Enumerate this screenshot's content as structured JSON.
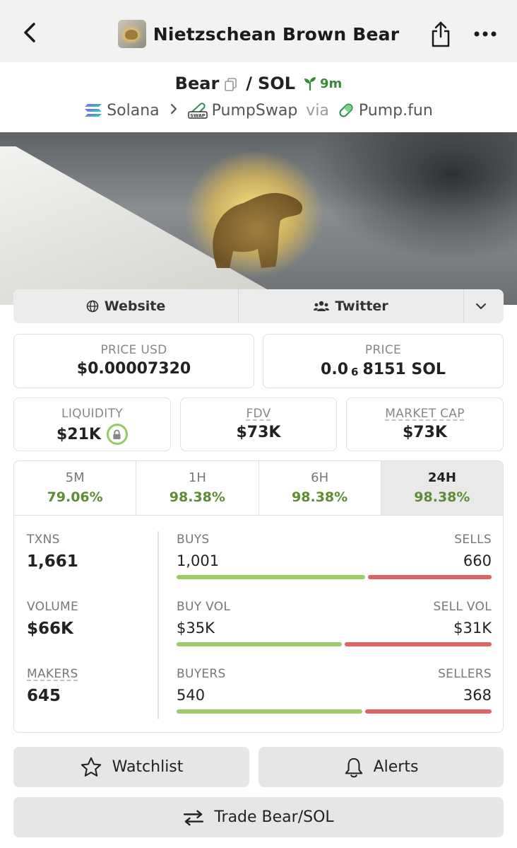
{
  "header": {
    "title": "Nietzschean Brown Bear"
  },
  "pair": {
    "base": "Bear",
    "slash": "/",
    "quote": "SOL",
    "age": "9m"
  },
  "chain": {
    "network": "Solana",
    "dex": "PumpSwap",
    "via": "via",
    "launchpad": "Pump.fun"
  },
  "links": {
    "website": "Website",
    "twitter": "Twitter"
  },
  "stats": {
    "price_usd_label": "PRICE USD",
    "price_usd": "$0.00007320",
    "price_label": "PRICE",
    "price_prefix": "0.0",
    "price_zeros": "6",
    "price_digits": "8151 SOL",
    "liquidity_label": "LIQUIDITY",
    "liquidity": "$21K",
    "fdv_label": "FDV",
    "fdv": "$73K",
    "mcap_label": "MARKET CAP",
    "mcap": "$73K"
  },
  "changes": [
    {
      "label": "5M",
      "value": "79.06%"
    },
    {
      "label": "1H",
      "value": "98.38%"
    },
    {
      "label": "6H",
      "value": "98.38%"
    },
    {
      "label": "24H",
      "value": "98.38%"
    }
  ],
  "metrics": {
    "txns_label": "TXNS",
    "txns": "1,661",
    "volume_label": "VOLUME",
    "volume": "$66K",
    "makers_label": "MAKERS",
    "makers": "645",
    "buys_label": "BUYS",
    "sells_label": "SELLS",
    "buys": "1,001",
    "sells": "660",
    "buy_ratio": 0.603,
    "buyvol_label": "BUY VOL",
    "sellvol_label": "SELL VOL",
    "buyvol": "$35K",
    "sellvol": "$31K",
    "buyvol_ratio": 0.53,
    "buyers_label": "BUYERS",
    "sellers_label": "SELLERS",
    "buyers": "540",
    "sellers": "368",
    "buyers_ratio": 0.595
  },
  "actions": {
    "watchlist": "Watchlist",
    "alerts": "Alerts",
    "trade": "Trade Bear/SOL"
  },
  "colors": {
    "positive": "#5d8d32",
    "buy_bar": "#9ecb66",
    "sell_bar": "#de6464",
    "age_green": "#3a8a3a"
  }
}
